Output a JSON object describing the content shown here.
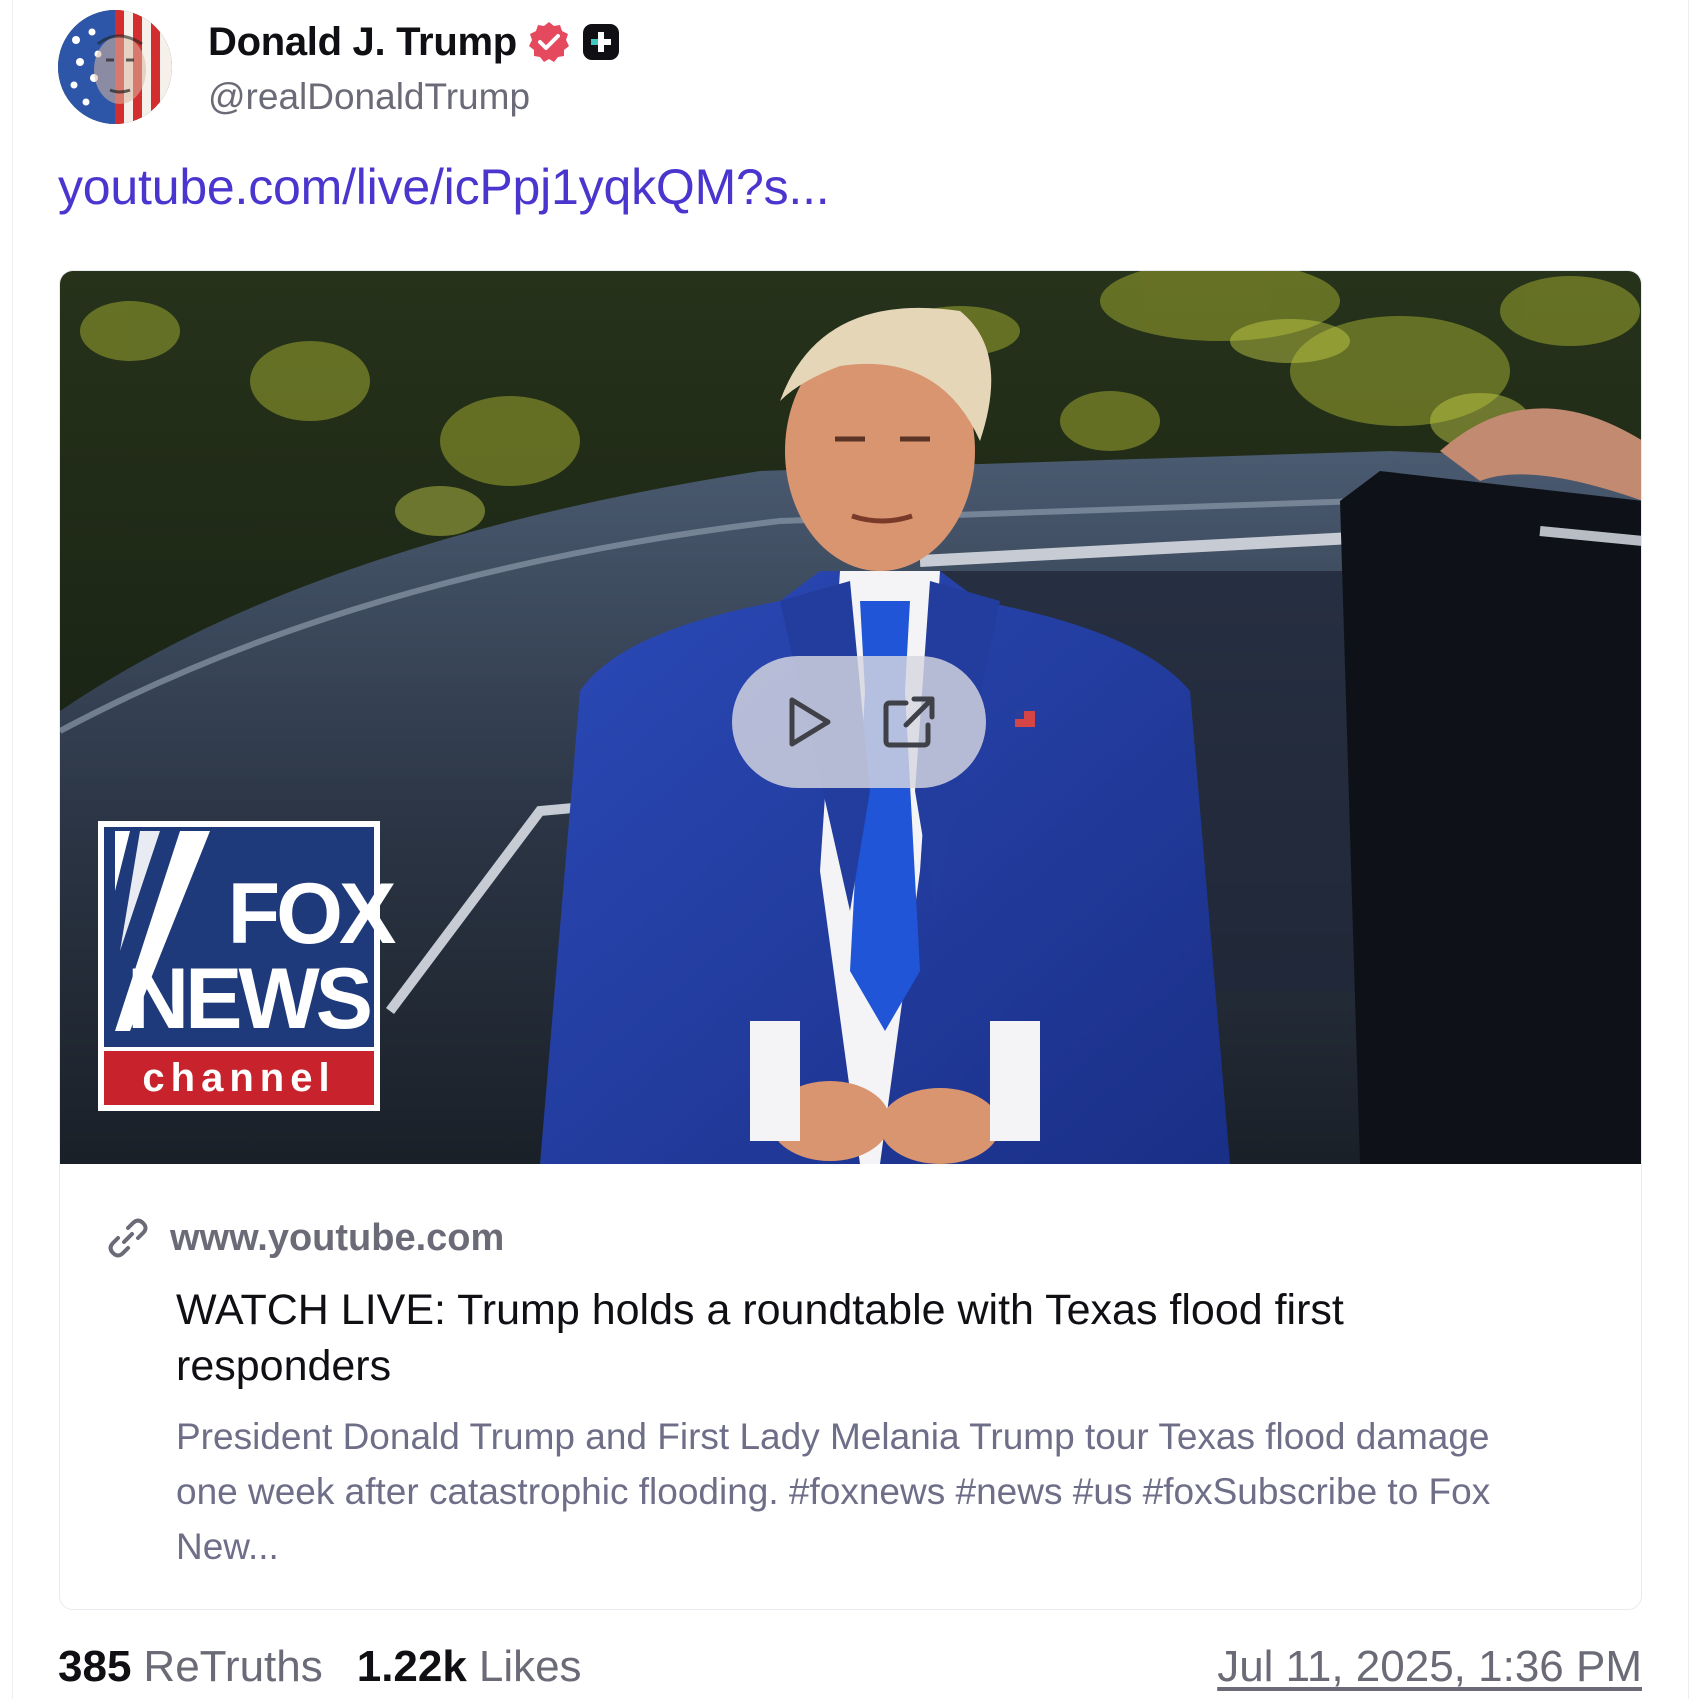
{
  "author": {
    "display_name": "Donald J. Trump",
    "handle": "@realDonaldTrump",
    "verified_icon": "verified-badge-icon",
    "plus_icon": "truth-plus-badge-icon"
  },
  "post": {
    "link_text": "youtube.com/live/icPpj1yqkQM?s..."
  },
  "card": {
    "domain": "www.youtube.com",
    "title": "WATCH LIVE: Trump holds a roundtable with Texas flood first responders",
    "description": "President Donald Trump and First Lady Melania Trump tour Texas flood damage one week after catastrophic flooding. #foxnews #news #us #foxSubscribe to Fox New...",
    "thumbnail": {
      "logo_line1": "FOX",
      "logo_line2": "NEWS",
      "logo_line3": "channel"
    },
    "controls": {
      "play_icon": "play-icon",
      "external_icon": "external-link-icon"
    }
  },
  "stats": {
    "retruths_count": "385",
    "retruths_label": "ReTruths",
    "likes_count": "1.22k",
    "likes_label": "Likes"
  },
  "timestamp": "Jul 11, 2025, 1:36 PM",
  "colors": {
    "link": "#4a36cf",
    "verified": "#e5495e",
    "text_primary": "#0f0f14",
    "text_secondary": "#6b6b78",
    "fox_blue": "#1e3a7a",
    "fox_red": "#c8232c"
  }
}
